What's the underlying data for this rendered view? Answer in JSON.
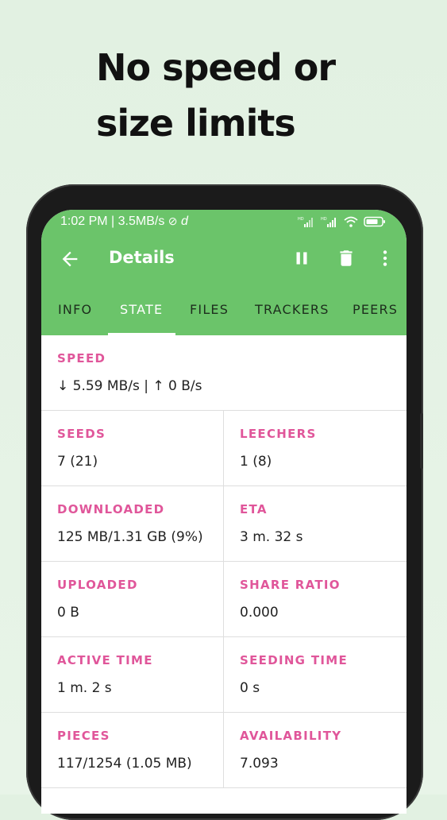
{
  "promo": {
    "line1": "No speed or",
    "line2": "size limits"
  },
  "status_bar": {
    "time_and_speed": "1:02 PM | 3.5MB/s",
    "extra_glyph": "d"
  },
  "toolbar": {
    "title": "Details",
    "back_icon": "arrow-back-icon",
    "pause_icon": "pause-icon",
    "delete_icon": "trash-icon",
    "menu_icon": "more-vert-icon"
  },
  "tabs": [
    {
      "label": "INFO",
      "active": false
    },
    {
      "label": "STATE",
      "active": true
    },
    {
      "label": "FILES",
      "active": false
    },
    {
      "label": "TRACKERS",
      "active": false
    },
    {
      "label": "PEERS",
      "active": false
    }
  ],
  "state": {
    "speed": {
      "label": "SPEED",
      "value": "↓ 5.59 MB/s | ↑ 0 B/s"
    },
    "seeds": {
      "label": "SEEDS",
      "value": "7 (21)"
    },
    "leechers": {
      "label": "LEECHERS",
      "value": "1 (8)"
    },
    "downloaded": {
      "label": "DOWNLOADED",
      "value": "125 MB/1.31 GB (9%)"
    },
    "eta": {
      "label": "ETA",
      "value": "3 m. 32 s"
    },
    "uploaded": {
      "label": "UPLOADED",
      "value": "0 B"
    },
    "share_ratio": {
      "label": "SHARE RATIO",
      "value": "0.000"
    },
    "active_time": {
      "label": "ACTIVE TIME",
      "value": "1 m. 2 s"
    },
    "seeding_time": {
      "label": "SEEDING TIME",
      "value": "0 s"
    },
    "pieces": {
      "label": "PIECES",
      "value": "117/1254 (1.05 MB)"
    },
    "availability": {
      "label": "AVAILABILITY",
      "value": "7.093"
    }
  },
  "colors": {
    "accent_green": "#6bc46a",
    "label_pink": "#e0569a",
    "background": "#e2f1e2"
  }
}
